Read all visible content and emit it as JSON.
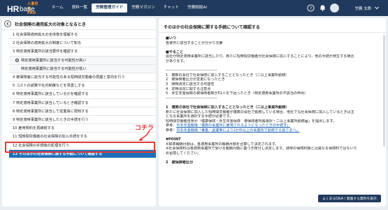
{
  "header": {
    "logo_pro": "人事労務 PRO",
    "logo_hr": "HR",
    "logo_base": "base",
    "nav": [
      "ホーム",
      "資料一覧",
      "労務管理ガイド",
      "労務マガジン",
      "チャット",
      "労務相談AI"
    ],
    "active_nav": "労務管理ガイド",
    "user_name": "労務 太郎",
    "icons": [
      "help-icon",
      "bell-icon",
      "avatar",
      "chevron-down-icon"
    ]
  },
  "left": {
    "title": "社会保険の適用拡大の対象となるとき",
    "items": [
      {
        "label": "1 社会保険適用拡大の全体像を理解する",
        "level": 0
      },
      {
        "label": "2 社会保険の適用拡大の制度について知る",
        "level": 0
      },
      {
        "label": "3 特定適用事業所の該当要件を確認する",
        "level": 0
      },
      {
        "label": "特定適用事業所に該当する可能性が高い",
        "level": 1,
        "radio": true
      },
      {
        "label": "特定適用事業所に該当する可能性が低い",
        "level": 2
      },
      {
        "label": "4 被保険者に該当する可能性のある短時間労働者の把握と意向を行う",
        "level": 0
      },
      {
        "label": "5 コストの試算や社内制度などを見直しする",
        "level": 0
      },
      {
        "label": "6 特定適用事業所に該当しているかを確認する",
        "level": 0
      },
      {
        "label": "7 特定適用事業所に該当しているとき確認する",
        "level": 0
      },
      {
        "label": "8 特定適用事業所に該当して従業員に周知する",
        "level": 0
      },
      {
        "label": "9 特定適用事業所に該当したときの手続を行う",
        "level": 0
      },
      {
        "label": "10 雇用契約を再締結する",
        "level": 0
      },
      {
        "label": "11 短時間労働者の社会保険の加入手続をする",
        "level": 0
      },
      {
        "label": "12 社会保険の手続後の処理を行う",
        "level": 0
      },
      {
        "label": "13 そのほかの社会保険に関する手続について確認する",
        "level": 0,
        "active": true
      }
    ],
    "callout": "コチラ"
  },
  "right": {
    "title": "そのほかの社会保険に関する手続について確認する",
    "lines": [
      {
        "t": "■いつ",
        "b": true
      },
      {
        "t": "各要件に該当することが分かり次第"
      },
      {
        "gap": true
      },
      {
        "t": "■やること",
        "b": true
      },
      {
        "t": "会社が特定適用事業所に該当したり、新たに短時間労働者が社会保険に加入することにより、他の手続が発生する場合"
      },
      {
        "t": "があります。"
      },
      {
        "gap": true
      },
      {
        "t": "----------------------------------------"
      },
      {
        "t": "1　複数の会社で社会保険に加入することとなったとき（二以上事業所勤務）"
      },
      {
        "t": "2　被保険者区分が変更になったとき"
      },
      {
        "t": "3　随時改定に該当する可能性"
      },
      {
        "t": "4　定時決定に関する注意点"
      },
      {
        "t": "5　厚生年金保険の被保険者数が51人を下回ったとき（特定適用事業所の不該当の申出）"
      },
      {
        "t": "----------------------------------------"
      },
      {
        "gap": true
      },
      {
        "t": "1　複数の会社で社会保険に加入することとなったとき（二以上事業所勤務）",
        "b": true
      },
      {
        "t": "新たに社会保険に加入した短時間労働者が複数の会社で勤務している場合、他社でも社会保険に加入しているときは主"
      },
      {
        "t": "となる事業所を選択する手続が必要です。"
      },
      {
        "t": "短時間労働者自身が「健康保険・厚生年金保険　被保険者所属選択・二以上事業所勤務届」を提出します。"
      },
      {
        "t": "参考：",
        "link": "日本年金機構「複数の事業所に雇用されるようになったときの手続き」"
      },
      {
        "t": "参考：",
        "link": "日本年金機構「兼業・副業等により2か所以上の事業所で勤務する皆さまへ」"
      },
      {
        "gap": true
      },
      {
        "t": "▼POINT",
        "b": true
      },
      {
        "t": "※標準報酬月額は、各適用事業所の報酬月額を合算して決定されます。"
      },
      {
        "t": "※社会保険料は各適用事業所で受ける報酬月額に基づき按分し決定します。通常の保険料額とは異なる保険料ではないた"
      },
      {
        "t": "め留意してください。"
      },
      {
        "gap": true
      },
      {
        "t": "2　被保険者区分",
        "b": true
      }
    ],
    "faq_button": "よくあるQ&A / 関連する資料を表示"
  },
  "colors": {
    "header_bg": "#1f3a5c",
    "active_row": "#1e6fb9",
    "highlight": "#e53935",
    "page_bg": "#e9eef2"
  }
}
